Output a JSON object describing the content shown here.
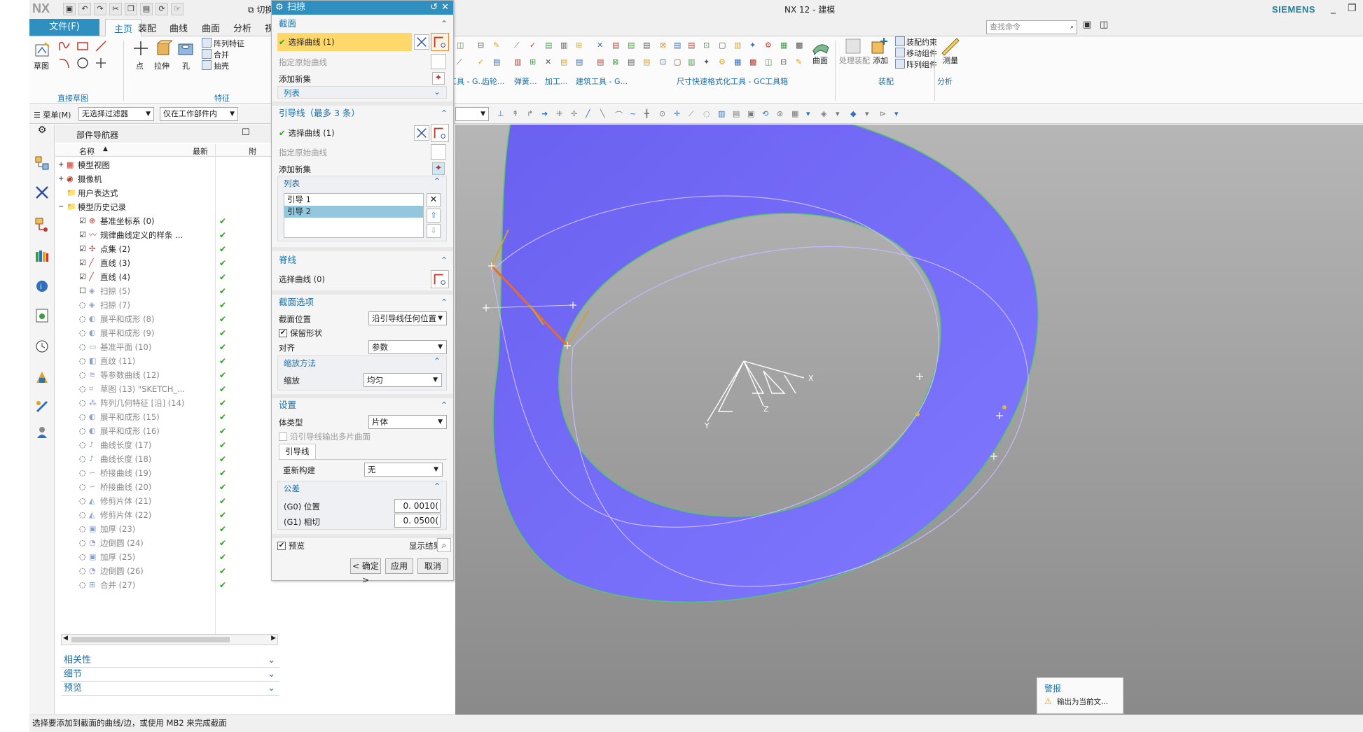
{
  "window": {
    "logo": "NX",
    "switch_window": "切换窗口",
    "title": "NX 12 - 建模",
    "brand": "SIEMENS",
    "search_placeholder": "查找命令"
  },
  "tabs": {
    "file": "文件(F)",
    "items": [
      "主页",
      "装配",
      "曲线",
      "曲面",
      "分析",
      "视图"
    ]
  },
  "ribbon": {
    "sketch": "草图",
    "direct_sketch_group": "直接草图",
    "point": "点",
    "extrude": "拉伸",
    "hole": "孔",
    "pattern_feature": "阵列特征",
    "unite": "合并",
    "shell": "抽壳",
    "feature_group": "特征",
    "curved_surface": "曲面",
    "std_tools": "标准化工具 - G...",
    "gear": "齿轮...",
    "spring": "弹簧...",
    "machining": "加工...",
    "building_tools": "建筑工具 - G...",
    "dim_tools": "尺寸快速格式化工具 - GC工具箱",
    "process_assembly": "处理装配",
    "add": "添加",
    "assembly_constraint": "装配约束",
    "move_component": "移动组件",
    "pattern_component": "阵列组件",
    "assembly_group": "装配",
    "measure": "测量",
    "analysis_group": "分析"
  },
  "selbar": {
    "menu": "菜单(M)",
    "filter": "无选择过滤器",
    "scope": "仅在工作部件内"
  },
  "navigator": {
    "title": "部件导航器",
    "col_name": "名称",
    "col_latest": "最新",
    "items": [
      {
        "label": "模型视图",
        "gray": false
      },
      {
        "label": "摄像机",
        "gray": false
      },
      {
        "label": "用户表达式",
        "gray": false
      },
      {
        "label": "模型历史记录",
        "gray": false
      },
      {
        "label": "基准坐标系 (0)",
        "gray": false
      },
      {
        "label": "规律曲线定义的样条 ...",
        "gray": false
      },
      {
        "label": "点集 (2)",
        "gray": false
      },
      {
        "label": "直线 (3)",
        "gray": false
      },
      {
        "label": "直线 (4)",
        "gray": false
      },
      {
        "label": "扫掠 (5)",
        "gray": true
      },
      {
        "label": "扫掠 (7)",
        "gray": true
      },
      {
        "label": "展平和成形 (8)",
        "gray": true
      },
      {
        "label": "展平和成形 (9)",
        "gray": true
      },
      {
        "label": "基准平面 (10)",
        "gray": true
      },
      {
        "label": "直纹 (11)",
        "gray": true
      },
      {
        "label": "等参数曲线 (12)",
        "gray": true
      },
      {
        "label": "草图 (13) \"SKETCH_...",
        "gray": true
      },
      {
        "label": "阵列几何特征 [沿] (14)",
        "gray": true
      },
      {
        "label": "展平和成形 (15)",
        "gray": true
      },
      {
        "label": "展平和成形 (16)",
        "gray": true
      },
      {
        "label": "曲线长度 (17)",
        "gray": true
      },
      {
        "label": "曲线长度 (18)",
        "gray": true
      },
      {
        "label": "桥接曲线 (19)",
        "gray": true
      },
      {
        "label": "桥接曲线 (20)",
        "gray": true
      },
      {
        "label": "修剪片体 (21)",
        "gray": true
      },
      {
        "label": "修剪片体 (22)",
        "gray": true
      },
      {
        "label": "加厚 (23)",
        "gray": true
      },
      {
        "label": "边倒圆 (24)",
        "gray": true
      },
      {
        "label": "加厚 (25)",
        "gray": true
      },
      {
        "label": "边倒圆 (26)",
        "gray": true
      },
      {
        "label": "合并 (27)",
        "gray": true
      }
    ],
    "sections": [
      "相关性",
      "细节",
      "预览"
    ]
  },
  "dialog": {
    "title": "扫掠",
    "section_curve": {
      "header": "截面",
      "select": "选择曲线 (1)",
      "specify_origin": "指定原始曲线",
      "add_new_set": "添加新集",
      "list": "列表"
    },
    "guide": {
      "header": "引导线（最多 3 条）",
      "select": "选择曲线 (1)",
      "specify_origin": "指定原始曲线",
      "add_new_set": "添加新集",
      "list": "列表",
      "items": [
        "引导 1",
        "引导 2"
      ],
      "selected_index": 1
    },
    "spine": {
      "header": "脊线",
      "select": "选择曲线 (0)"
    },
    "section_options": {
      "header": "截面选项",
      "position_label": "截面位置",
      "position_value": "沿引导线任何位置",
      "keep_shape": "保留形状",
      "align_label": "对齐",
      "align_value": "参数",
      "scaling_header": "缩放方法",
      "scaling_label": "缩放",
      "scaling_value": "均匀"
    },
    "settings": {
      "header": "设置",
      "body_type_label": "体类型",
      "body_type_value": "片体",
      "multi_sheet": "沿引导线输出多片曲面",
      "tab_guide": "引导线",
      "rebuild_label": "重新构建",
      "rebuild_value": "无",
      "tolerance_header": "公差",
      "g0_label": "(G0) 位置",
      "g0_value": "0. 0010(",
      "g1_label": "(G1) 相切",
      "g1_value": "0. 0500("
    },
    "preview": "预览",
    "show_result": "显示结果",
    "ok": "< 确定 >",
    "apply": "应用",
    "cancel": "取消"
  },
  "viewport": {
    "axis_x": "X",
    "axis_y": "Y",
    "axis_z": "Z"
  },
  "alert": {
    "title": "警报",
    "message": "输出为当前文..."
  },
  "status": "选择要添加到截面的曲线/边，或使用 MB2 来完成截面"
}
